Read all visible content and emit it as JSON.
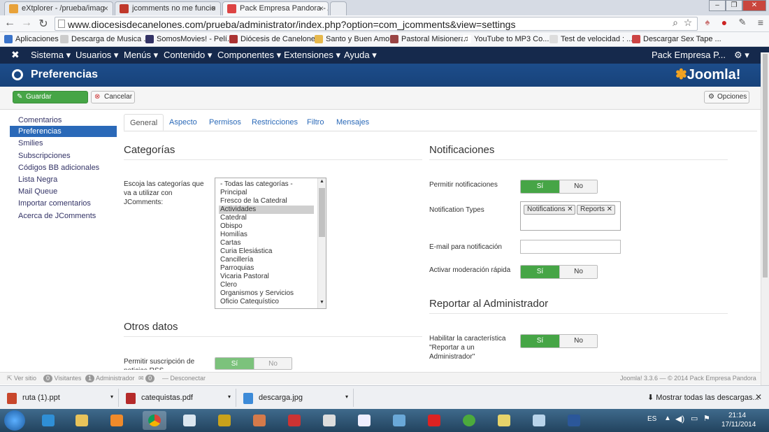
{
  "browser": {
    "tabs": [
      {
        "title": "eXtplorer - /prueba/imag"
      },
      {
        "title": "jcomments no me funcio"
      },
      {
        "title": "Pack Empresa Pandora - A"
      }
    ],
    "url": "www.diocesisdecanelones.com/prueba/administrator/index.php?option=com_jcomments&view=settings",
    "bookmarks": [
      "Aplicaciones",
      "Descarga de Musica ...",
      "SomosMovies! - Pelí...",
      "Diócesis de Canelones",
      "Santo y Buen Amor",
      "Pastoral Misionera",
      "YouTube to MP3 Co...",
      "Test de velocidad : ...",
      "Descargar Sex Tape ..."
    ]
  },
  "navbar": {
    "menus": [
      "Sistema",
      "Usuarios",
      "Menús",
      "Contenido",
      "Componentes",
      "Extensiones",
      "Ayuda"
    ],
    "site_name": "Pack Empresa P..."
  },
  "header": {
    "title": "Preferencias",
    "logo_text": "Joomla!"
  },
  "toolbar": {
    "save_label": "Guardar",
    "cancel_label": "Cancelar",
    "options_label": "Opciones"
  },
  "sidebar": {
    "items": [
      "Comentarios",
      "Preferencias",
      "Smilies",
      "Subscripciones",
      "Códigos BB adicionales",
      "Lista Negra",
      "Mail Queue",
      "Importar comentarios",
      "Acerca de JComments"
    ],
    "active_index": 1
  },
  "content_tabs": [
    "General",
    "Aspecto",
    "Permisos",
    "Restricciones",
    "Filtro",
    "Mensajes"
  ],
  "categorias": {
    "heading": "Categorías",
    "label": "Escoja las categorías que va a utilizar con JComments:",
    "options": [
      "- Todas las categorías -",
      "Principal",
      "Fresco de la Catedral",
      "Actividades",
      "Catedral",
      "Obispo",
      "Homilías",
      "Cartas",
      "Curia Elesiástica",
      "Cancillería",
      "Parroquias",
      "Vicaria Pastoral",
      "Clero",
      "Organismos y Servicios",
      "Oficio Catequístico"
    ],
    "selected_index": 3
  },
  "otros": {
    "heading": "Otros datos",
    "rss_label": "Permitir suscripción de noticias RSS",
    "yes": "Sí",
    "no": "No"
  },
  "notificaciones": {
    "heading": "Notificaciones",
    "allow_label": "Permitir notificaciones",
    "types_label": "Notification Types",
    "types": [
      "Notifications",
      "Reports"
    ],
    "email_label": "E-mail para notificación",
    "email_value": "",
    "quick_mod_label": "Activar moderación rápida",
    "yes": "Sí",
    "no": "No"
  },
  "reportar": {
    "heading": "Reportar al Administrador",
    "feature_label": "Habilitar la característica \"Reportar a un Administrador\"",
    "yes": "Sí",
    "no": "No"
  },
  "statusbar": {
    "view_site": "Ver sitio",
    "visitors_count": "0",
    "visitors_label": "Visitantes",
    "admins_count": "1",
    "admins_label": "Administrador",
    "messages_count": "0",
    "logout": "Desconectar",
    "footer": "Joomla! 3.3.6 — © 2014 Pack Empresa Pandora"
  },
  "downloads": {
    "items": [
      "ruta (1).ppt",
      "catequistas.pdf",
      "descarga.jpg"
    ],
    "show_all": "Mostrar todas las descargas..."
  },
  "taskbar": {
    "lang": "ES",
    "time": "21:14",
    "date": "17/11/2014"
  },
  "colors": {
    "navbar": "#15294c",
    "header": "#1b4a86",
    "accent": "#2a69b8",
    "success": "#46a546"
  }
}
